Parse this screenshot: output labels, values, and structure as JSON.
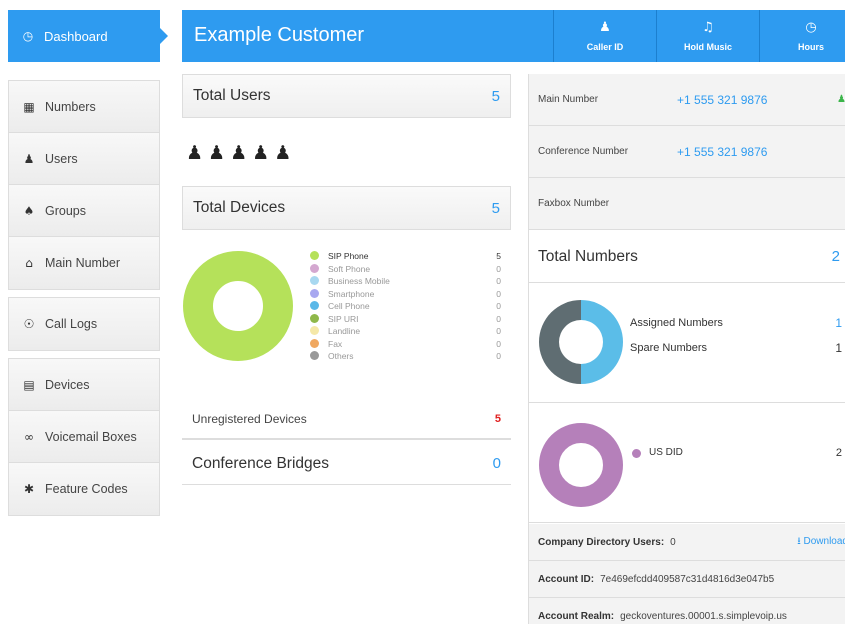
{
  "sidebar": {
    "active": {
      "label": "Dashboard",
      "icon": "gauge-icon"
    },
    "items": [
      {
        "label": "Numbers",
        "icon": "grid-icon"
      },
      {
        "label": "Users",
        "icon": "users-icon"
      },
      {
        "label": "Groups",
        "icon": "group-icon"
      },
      {
        "label": "Main Number",
        "icon": "home-icon"
      },
      {
        "label": "Call Logs",
        "icon": "call-logs-icon"
      },
      {
        "label": "Devices",
        "icon": "device-icon"
      },
      {
        "label": "Voicemail Boxes",
        "icon": "voicemail-icon"
      },
      {
        "label": "Feature Codes",
        "icon": "asterisk-icon"
      }
    ]
  },
  "header": {
    "title": "Example Customer",
    "buttons": [
      {
        "label": "Caller ID",
        "icon": "user-icon"
      },
      {
        "label": "Hold Music",
        "icon": "music-icon"
      },
      {
        "label": "Hours",
        "icon": "clock-icon"
      }
    ]
  },
  "total_users": {
    "label": "Total Users",
    "value": "5",
    "icon_count": 5
  },
  "total_devices": {
    "label": "Total Devices",
    "value": "5",
    "legend": [
      {
        "name": "SIP Phone",
        "count": "5",
        "color": "#b5e15a"
      },
      {
        "name": "Soft Phone",
        "count": "0",
        "color": "#d4a8d0"
      },
      {
        "name": "Business Mobile",
        "count": "0",
        "color": "#a8d8f0"
      },
      {
        "name": "Smartphone",
        "count": "0",
        "color": "#a8a8f0"
      },
      {
        "name": "Cell Phone",
        "count": "0",
        "color": "#5bb8e8"
      },
      {
        "name": "SIP URI",
        "count": "0",
        "color": "#8fb84a"
      },
      {
        "name": "Landline",
        "count": "0",
        "color": "#f5e8a8"
      },
      {
        "name": "Fax",
        "count": "0",
        "color": "#f0a860"
      },
      {
        "name": "Others",
        "count": "0",
        "color": "#999999"
      }
    ]
  },
  "unregistered": {
    "label": "Unregistered Devices",
    "value": "5"
  },
  "conference_bridges": {
    "label": "Conference Bridges",
    "value": "0"
  },
  "numbers": {
    "main": {
      "label": "Main Number",
      "value": "+1 555 321 9876"
    },
    "conference": {
      "label": "Conference Number",
      "value": "+1 555 321 9876"
    },
    "faxbox": {
      "label": "Faxbox Number",
      "value": ""
    }
  },
  "total_numbers": {
    "label": "Total Numbers",
    "value": "2",
    "assigned": {
      "label": "Assigned Numbers",
      "value": "1",
      "color": "#5bbde8"
    },
    "spare": {
      "label": "Spare Numbers",
      "value": "1",
      "color": "#5f6d72"
    },
    "us_did": {
      "label": "US DID",
      "value": "2",
      "color": "#b580ba"
    }
  },
  "footer": {
    "directory": {
      "label": "Company Directory Users:",
      "value": "0",
      "download": "Download"
    },
    "account_id": {
      "label": "Account ID:",
      "value": "7e469efcdd409587c31d4816d3e047b5"
    },
    "realm": {
      "label": "Account Realm:",
      "value": "geckoventures.00001.s.simplevoip.us"
    }
  }
}
